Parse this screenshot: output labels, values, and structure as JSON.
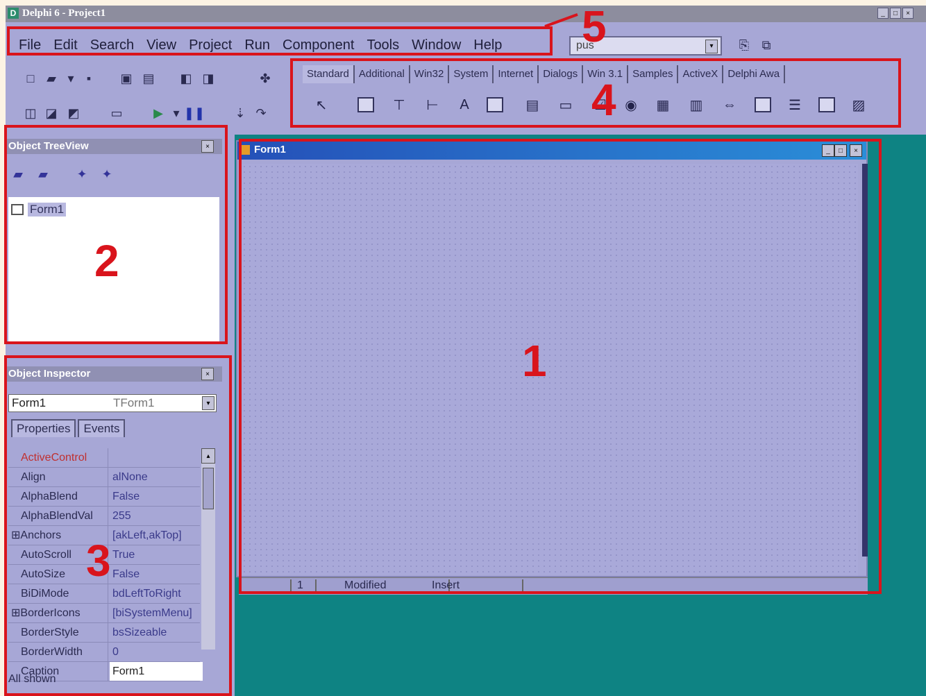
{
  "window": {
    "title": "Delphi 6 - Project1",
    "minimize": "_",
    "maximize": "□",
    "close": "×"
  },
  "menu": [
    "File",
    "Edit",
    "Search",
    "View",
    "Project",
    "Run",
    "Component",
    "Tools",
    "Window",
    "Help"
  ],
  "desktop_combo": {
    "value": "pus",
    "arrow": "▾"
  },
  "palette": {
    "tabs": [
      "Standard",
      "Additional",
      "Win32",
      "System",
      "Internet",
      "Dialogs",
      "Win 3.1",
      "Samples",
      "ActiveX",
      "Delphi Awa"
    ],
    "components": [
      "pointer-icon",
      "frame-icon",
      "mainmenu-icon",
      "popupmenu-icon",
      "label-icon",
      "edit-icon",
      "memo-icon",
      "button-icon",
      "checkbox-icon",
      "radiobutton-icon",
      "listbox-icon",
      "combobox-icon",
      "scrollbar-icon",
      "groupbox-icon",
      "radiogroup-icon",
      "panel-icon",
      "actionlist-icon"
    ]
  },
  "tree_view": {
    "title": "Object TreeView",
    "close": "×",
    "node": "Form1"
  },
  "object_inspector": {
    "title": "Object Inspector",
    "close": "×",
    "selected_name": "Form1",
    "selected_type": "TForm1",
    "tabs": [
      "Properties",
      "Events"
    ],
    "rows": [
      {
        "key": "ActiveControl",
        "value": "",
        "red": true
      },
      {
        "key": "Align",
        "value": "alNone"
      },
      {
        "key": "AlphaBlend",
        "value": "False"
      },
      {
        "key": "AlphaBlendVal",
        "value": "255"
      },
      {
        "key": "Anchors",
        "value": "[akLeft,akTop]",
        "expand": "⊞"
      },
      {
        "key": "AutoScroll",
        "value": "True"
      },
      {
        "key": "AutoSize",
        "value": "False"
      },
      {
        "key": "BiDiMode",
        "value": "bdLeftToRight"
      },
      {
        "key": "BorderIcons",
        "value": "[biSystemMenu]",
        "expand": "⊞"
      },
      {
        "key": "BorderStyle",
        "value": "bsSizeable"
      },
      {
        "key": "BorderWidth",
        "value": "0"
      },
      {
        "key": "Caption",
        "value": "Form1",
        "selected": true
      }
    ],
    "status": "All shown"
  },
  "form": {
    "title": "Form1",
    "minimize": "_",
    "maximize": "□",
    "close": "×"
  },
  "editor_status": {
    "position": "1",
    "modified": "Modified",
    "mode": "Insert"
  },
  "annotations": [
    "1",
    "2",
    "3",
    "4",
    "5"
  ],
  "colors": {
    "annotation": "#d9141c",
    "ide_bg": "#a7a7d6",
    "desktop": "#0e8383",
    "form_title": "#2550b8"
  }
}
